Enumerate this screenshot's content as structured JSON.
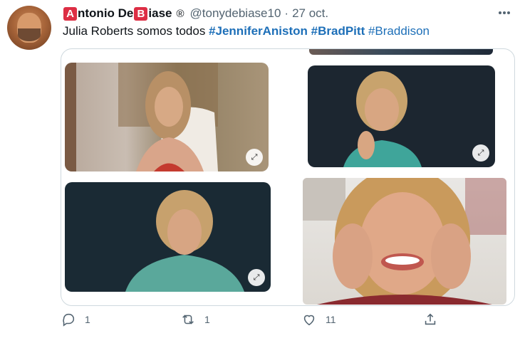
{
  "author": {
    "name_letter1": "A",
    "name_part1": "ntonio De ",
    "name_letter2": "B",
    "name_part2": "iase",
    "registered": "®",
    "handle": "@tonydebiase10",
    "separator": "·",
    "date": "27 oct."
  },
  "tweet": {
    "text": "Julia Roberts somos todos",
    "hashtags": [
      "#JenniferAniston",
      "#BradPitt",
      "#Braddison"
    ]
  },
  "media": {
    "expand_glyph": "⤢"
  },
  "actions": {
    "reply_count": "1",
    "retweet_count": "1",
    "like_count": "11"
  },
  "colors": {
    "link": "#1d6fb8",
    "muted": "#536471",
    "letter_box": "#dd2e44"
  },
  "icons": [
    "more-icon",
    "reply-icon",
    "retweet-icon",
    "like-icon",
    "share-icon",
    "expand-icon"
  ]
}
